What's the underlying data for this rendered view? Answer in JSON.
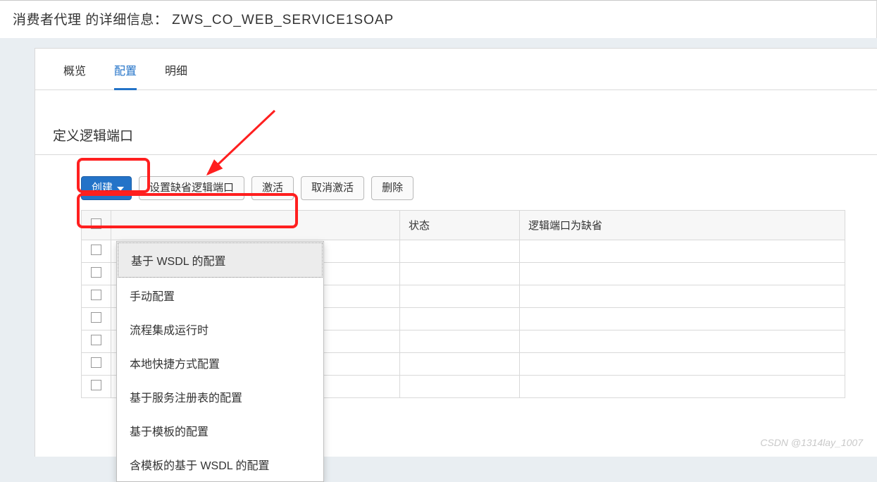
{
  "header": {
    "prefix": "消费者代理 的详细信息：",
    "code": "ZWS_CO_WEB_SERVICE1SOAP"
  },
  "tabs": [
    {
      "label": "概览",
      "active": false
    },
    {
      "label": "配置",
      "active": true
    },
    {
      "label": "明细",
      "active": false
    }
  ],
  "section_title": "定义逻辑端口",
  "toolbar": {
    "create_label": "创建",
    "set_default_port_label": "设置缺省逻辑端口",
    "activate_label": "激活",
    "deactivate_label": "取消激活",
    "delete_label": "删除"
  },
  "create_menu": {
    "items": [
      "基于 WSDL 的配置",
      "手动配置",
      "流程集成运行时",
      "本地快捷方式配置",
      "基于服务注册表的配置",
      "基于模板的配置",
      "含模板的基于 WSDL 的配置"
    ]
  },
  "table": {
    "columns": {
      "state": "状态",
      "default_port": "逻辑端口为缺省"
    },
    "empty_rows": 7
  },
  "watermark": "CSDN @1314lay_1007"
}
